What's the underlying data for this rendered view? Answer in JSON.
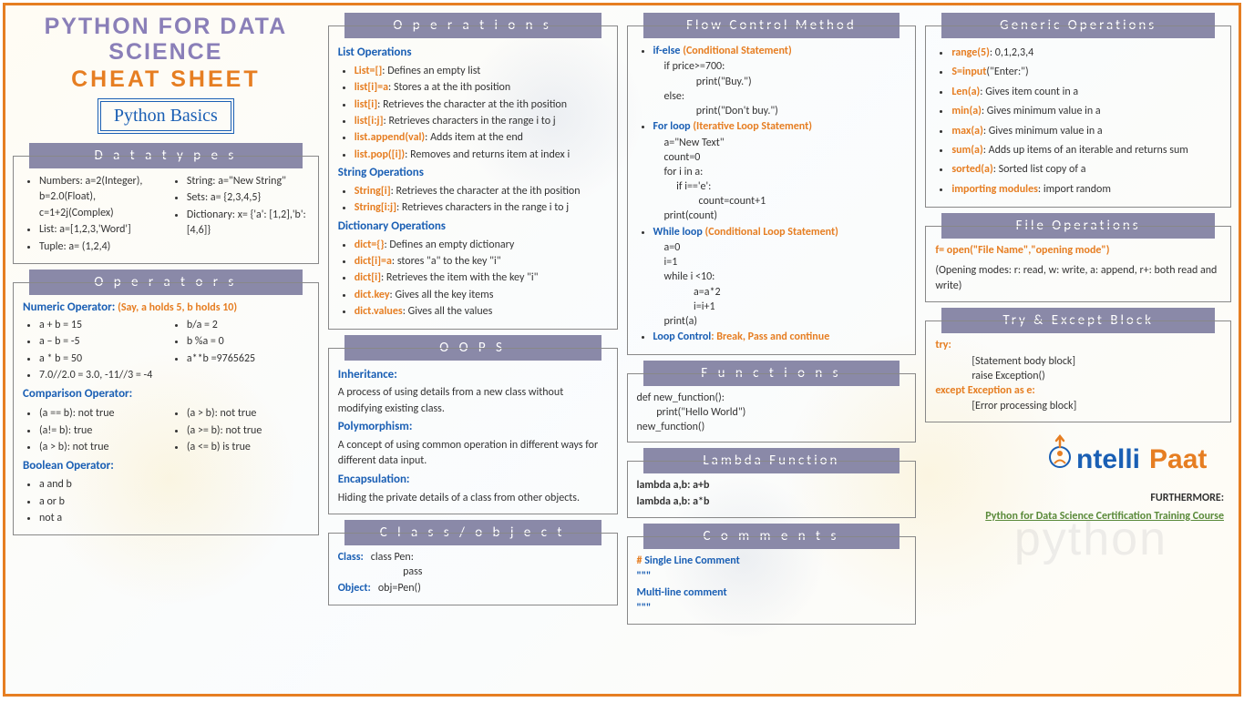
{
  "title": {
    "l1": "PYTHON FOR DATA",
    "l2": "SCIENCE",
    "l3": "CHEAT SHEET",
    "badge": "Python Basics"
  },
  "datatypes": {
    "hdr": "D a t a t y p e s",
    "left": [
      "Numbers: a=2(Integer), b=2.0(Float), c=1+2j(Complex)",
      "List: a=[1,2,3,'Word']",
      "Tuple: a= (1,2,4)"
    ],
    "right": [
      "String: a=\"New String\"",
      "Sets: a= {2,3,4,5}",
      "Dictionary: x= {'a': [1,2],'b': [4,6]}"
    ]
  },
  "operators": {
    "hdr": "O p e r a t o r s",
    "numTitle": "Numeric Operator:",
    "numNote": "(Say, a holds 5, b holds 10)",
    "numL": [
      "a + b = 15",
      "a – b = -5",
      "a * b = 50",
      "7.0//2.0 = 3.0, -11//3 = -4"
    ],
    "numR": [
      "b/a = 2",
      "b %a = 0",
      "a**b =9765625"
    ],
    "cmpTitle": "Comparison Operator:",
    "cmpL": [
      "(a == b): not true",
      "(a!= b): true",
      "(a > b): not true"
    ],
    "cmpR": [
      "(a > b): not true",
      "(a >= b): not true",
      "(a <= b) is true"
    ],
    "boolTitle": "Boolean Operator:",
    "bool": [
      "a and b",
      "a or b",
      "not a"
    ]
  },
  "operations": {
    "hdr": "O p e r a t i o n s",
    "listTitle": "List Operations",
    "list": [
      [
        "List=[]",
        ": Defines an empty list"
      ],
      [
        "list[i]=a",
        ": Stores a at the ith position"
      ],
      [
        "list[i]",
        ": Retrieves the character at the ith position"
      ],
      [
        "list[i:j]",
        ": Retrieves characters in the range i to j"
      ],
      [
        "list.append(val)",
        ": Adds item at the end"
      ],
      [
        "list.pop([i])",
        ": Removes and returns item at index i"
      ]
    ],
    "strTitle": "String Operations",
    "str": [
      [
        "String[i]",
        ": Retrieves the character at the ith position"
      ],
      [
        "String[i:j]",
        ": Retrieves characters in the range i to j"
      ]
    ],
    "dictTitle": "Dictionary Operations",
    "dict": [
      [
        "dict={}",
        ": Defines an empty dictionary"
      ],
      [
        "dict[i]=a",
        ": stores \"a\" to the key \"i\""
      ],
      [
        "dict[i]",
        ": Retrieves the item with the key \"i\""
      ],
      [
        "dict.key",
        ": Gives all the key items"
      ],
      [
        "dict.values",
        ": Gives all the values"
      ]
    ]
  },
  "oops": {
    "hdr": "O O P S",
    "inh": "Inheritance:",
    "inhT": "A process of using details from a new class without modifying existing class.",
    "poly": "Polymorphism:",
    "polyT": "A concept of using common operation in different ways for different data input.",
    "enc": "Encapsulation:",
    "encT": "Hiding the private details of a class from other objects."
  },
  "classobj": {
    "hdr": "C l a s s / o b j e c t",
    "cls": "Class:",
    "clsC": "class Pen:\n             pass",
    "obj": "Object:",
    "objC": "obj=Pen()"
  },
  "flow": {
    "hdr": "Flow Control Method",
    "ifT": "if-else",
    "ifN": "(Conditional Statement)",
    "ifC": "if price>=700:\n             print(\"Buy.\")\nelse:\n             print(\"Don't buy.\")",
    "forT": "For loop",
    "forN": "(Iterative Loop Statement)",
    "forC": "a=\"New Text\"\ncount=0\nfor i in a:\n     if i=='e':\n              count=count+1\nprint(count)",
    "whT": "While loop",
    "whN": "(Conditional Loop Statement)",
    "whC": "a=0\ni=1\nwhile i <10:\n            a=a*2\n            i=i+1\nprint(a)",
    "lcT": "Loop Control",
    "lcC": ": Break, Pass and continue"
  },
  "functions": {
    "hdr": "F u n c t i o n s",
    "code": "def new_function():\n        print(\"Hello World\")\nnew_function()"
  },
  "lambda": {
    "hdr": "Lambda Function",
    "l1": "lambda a,b: a+b",
    "l2": "lambda a,b: a*b"
  },
  "comments": {
    "hdr": "C o m m e n t s",
    "s": "# Single Line Comment",
    "m1": "\"\"\"",
    "m2": "Multi-line comment",
    "m3": "\"\"\""
  },
  "generic": {
    "hdr": "Generic Operations",
    "items": [
      [
        "range(5)",
        ": 0,1,2,3,4"
      ],
      [
        "S=input",
        "(\"Enter:\")"
      ],
      [
        "Len(a)",
        ": Gives item count in a"
      ],
      [
        "min(a)",
        ": Gives minimum value in a"
      ],
      [
        "max(a)",
        ": Gives minimum value in a"
      ],
      [
        "sum(a)",
        ": Adds up items of an iterable and returns sum"
      ],
      [
        "sorted(a)",
        ": Sorted list copy of a"
      ],
      [
        "importing modules",
        ":  import random"
      ]
    ]
  },
  "fileops": {
    "hdr": "File Operations",
    "l1": "f= open(\"File Name\",\"opening mode\")",
    "l2": "(Opening modes: r: read, w: write, a: append, r+: both read and write)"
  },
  "tryexcept": {
    "hdr": "Try & Except Block",
    "try": "try:",
    "tryB": "[Statement body block]\nraise Exception()",
    "exc": "except Exception as e:",
    "excB": "[Error processing block]"
  },
  "footer": {
    "more": "FURTHERMORE:",
    "link": "Python for Data Science Certification Training Course"
  }
}
